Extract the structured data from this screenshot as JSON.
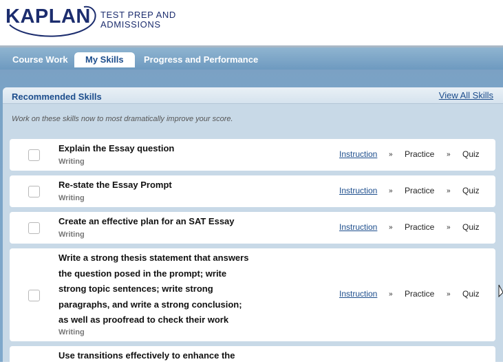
{
  "logo": {
    "brand": "KAPLAN",
    "line1": "TEST PREP AND",
    "line2": "ADMISSIONS"
  },
  "nav": {
    "tabs": [
      {
        "label": "Course Work",
        "active": false
      },
      {
        "label": "My Skills",
        "active": true
      },
      {
        "label": "Progress and Performance",
        "active": false
      }
    ]
  },
  "panel": {
    "title": "Recommended Skills",
    "view_all_label": "View All Skills",
    "intro": "Work on these skills now to most dramatically improve your score."
  },
  "skills": [
    {
      "title": "Explain the Essay question",
      "category": "Writing",
      "instruction_label": "Instruction",
      "practice_label": "Practice",
      "quiz_label": "Quiz",
      "separator": "»"
    },
    {
      "title": "Re-state the Essay Prompt",
      "category": "Writing",
      "instruction_label": "Instruction",
      "practice_label": "Practice",
      "quiz_label": "Quiz",
      "separator": "»"
    },
    {
      "title": "Create an effective plan for an SAT Essay",
      "category": "Writing",
      "instruction_label": "Instruction",
      "practice_label": "Practice",
      "quiz_label": "Quiz",
      "separator": "»"
    },
    {
      "title": "Write a strong thesis statement that answers the question posed in the prompt; write strong topic sentences; write strong paragraphs, and write a strong conclusion; as well as proofread to check their work",
      "category": "Writing",
      "instruction_label": "Instruction",
      "practice_label": "Practice",
      "quiz_label": "Quiz",
      "separator": "»"
    },
    {
      "title": "Use transitions effectively to enhance the",
      "category": "",
      "instruction_label": "",
      "practice_label": "",
      "quiz_label": "",
      "separator": ""
    }
  ],
  "colors": {
    "brand_navy": "#1c2d6e",
    "link_blue": "#1c4d8c",
    "nav_bg": "#7ba1c4",
    "panel_bg": "#c8d9e7"
  }
}
